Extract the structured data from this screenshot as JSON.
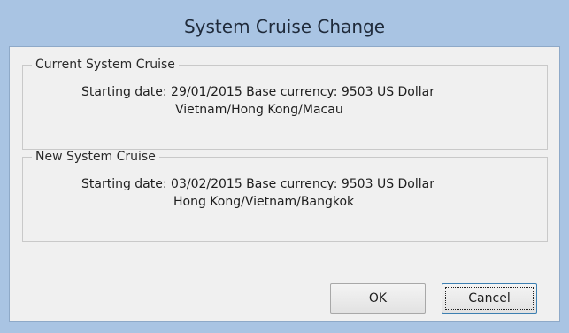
{
  "window": {
    "title": "System Cruise Change"
  },
  "current": {
    "label": "Current System Cruise",
    "line1": "Starting date: 29/01/2015   Base currency: 9503 US Dollar",
    "line2": "Vietnam/Hong Kong/Macau"
  },
  "new": {
    "label": "New System Cruise",
    "line1": "Starting date: 03/02/2015   Base currency: 9503 US Dollar",
    "line2": "Hong Kong/Vietnam/Bangkok"
  },
  "buttons": {
    "ok_label": "OK",
    "cancel_label": "Cancel"
  },
  "colors": {
    "frame": "#a9c4e3",
    "client": "#f0f0f0",
    "focus_border": "#3c7fb1"
  }
}
